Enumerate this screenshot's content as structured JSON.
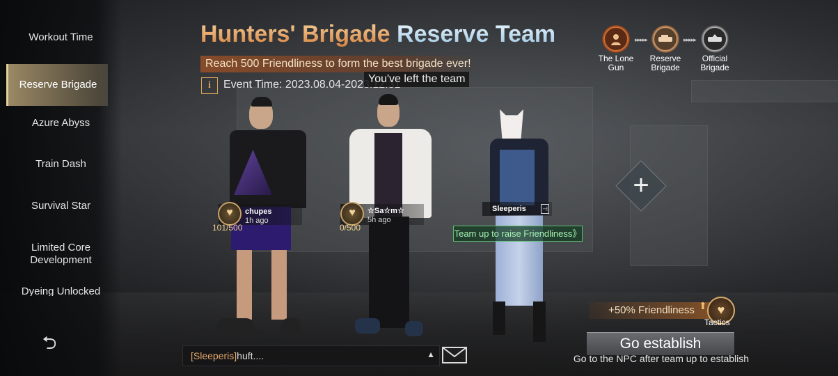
{
  "sidebar": {
    "items": [
      {
        "label": "Workout Time"
      },
      {
        "label": "Reserve Brigade"
      },
      {
        "label": "Azure Abyss"
      },
      {
        "label": "Train Dash"
      },
      {
        "label": "Survival Star"
      },
      {
        "label": "Limited Core Development"
      },
      {
        "label": "Dyeing Unlocked"
      }
    ],
    "active_index": 1
  },
  "title": {
    "part1": "Hunters' Brigade",
    "part2": "Reserve Team"
  },
  "banner": "Reach 500 Friendliness to form the best brigade ever!",
  "event": {
    "info_icon": "i",
    "text": "Event Time: 2023.08.04-2023.12.31"
  },
  "toast": "You've left the team",
  "progress": [
    {
      "label": "The Lone Gun",
      "state": "done"
    },
    {
      "label": "Reserve Brigade",
      "state": "current"
    },
    {
      "label": "Official Brigade",
      "state": "locked"
    }
  ],
  "members": [
    {
      "name": "chupes",
      "time": "1h ago",
      "friendliness": "101/500",
      "progress": 0.202
    },
    {
      "name": "☆Sa☆m☆",
      "time": "5h ago",
      "friendliness": "0/500",
      "progress": 0
    },
    {
      "name": "Sleeperis",
      "time": "",
      "friendliness": ""
    }
  ],
  "team_hint": "Team up to raise Friendliness》",
  "bonus": "+50% Friendliness",
  "tactics_label": "Tactics",
  "establish": {
    "button": "Go establish",
    "hint": "Go to the NPC after team up to establish"
  },
  "chat": {
    "sender": "[Sleeperis]",
    "message": "huft...."
  },
  "icons": {
    "back": "back-arrow-icon",
    "mail": "mail-icon",
    "add": "plus-icon",
    "heart": "heart-icon"
  }
}
